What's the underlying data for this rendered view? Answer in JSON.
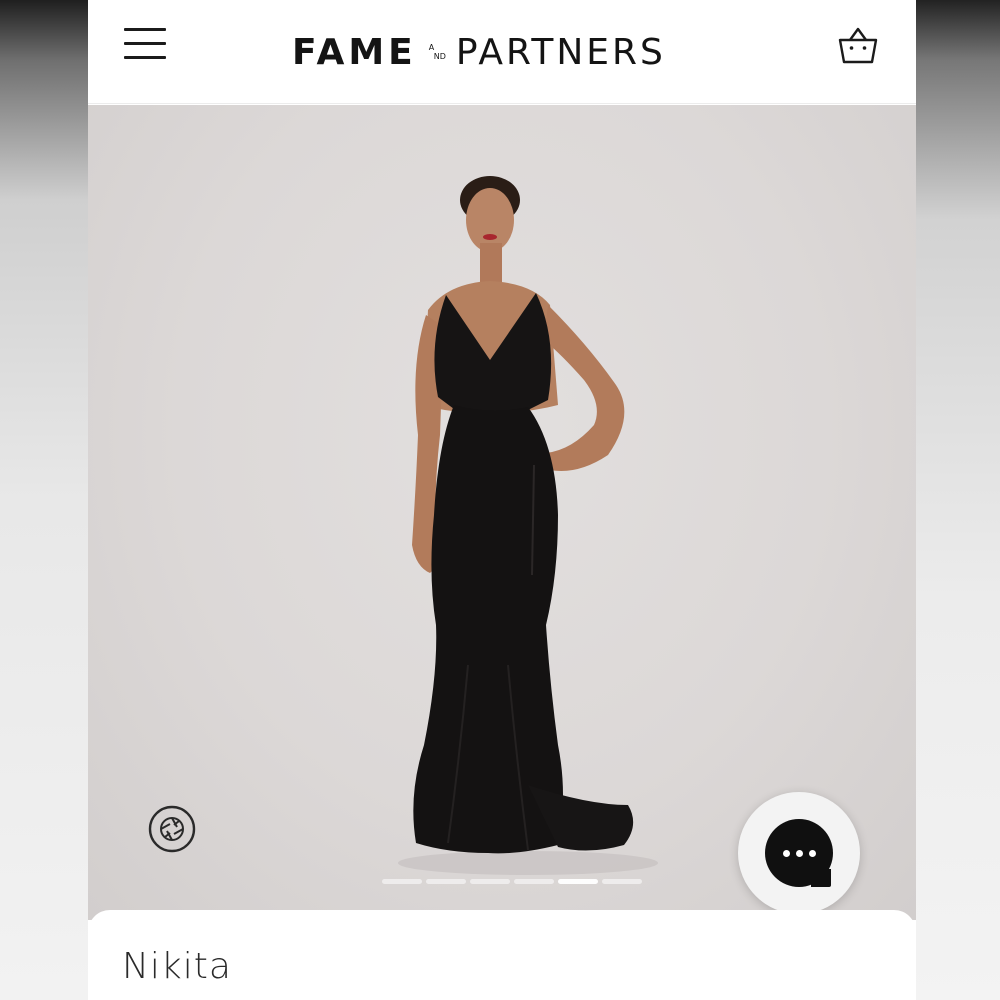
{
  "header": {
    "logo_primary": "FAME",
    "logo_and_top": "A",
    "logo_and_bottom": "ND",
    "logo_secondary": "PARTNERS",
    "menu_icon": "hamburger-menu-icon",
    "cart_icon": "shopping-bag-icon"
  },
  "gallery": {
    "slide_count": 6,
    "active_slide": 5,
    "camera_icon": "camera-aperture-icon"
  },
  "chat": {
    "icon": "chat-bubble-icon"
  },
  "product": {
    "name": "Nikita"
  },
  "colors": {
    "brand_text": "#141414",
    "hero_bg": "#dcd8d7",
    "dress": "#141414"
  }
}
